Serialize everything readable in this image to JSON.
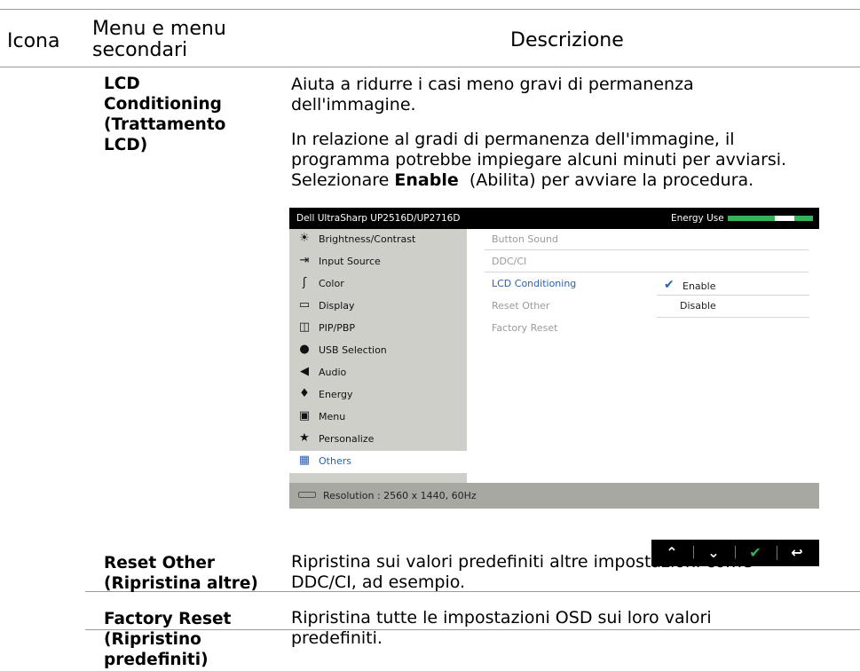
{
  "header": {
    "col_icon": "Icona",
    "col_menu_line1": "Menu e menu",
    "col_menu_line2": "secondari",
    "col_desc": "Descrizione"
  },
  "rows": [
    {
      "term_lines": [
        "LCD",
        "Conditioning",
        "(Trattamento",
        "LCD)"
      ],
      "desc_lines": [
        "Aiuta a ridurre i casi meno gravi di permanenza",
        "dell'immagine."
      ],
      "desc2_lines": [
        "In relazione al gradi di permanenza dell'immagine, il",
        "programma potrebbe impiegare alcuni minuti per avviarsi."
      ],
      "desc3_pre": "Selezionare ",
      "desc3_bold": "Enable",
      "desc3_post": "  (Abilita) per avviare la procedura."
    },
    {
      "term_lines": [
        "Reset Other",
        "(Ripristina altre)"
      ],
      "desc_lines": [
        "Ripristina sui valori predefiniti altre impostazioni come",
        "DDC/CI, ad esempio."
      ]
    },
    {
      "term_lines": [
        "Factory Reset",
        "(Ripristino",
        "predefiniti)"
      ],
      "desc_lines": [
        "Ripristina tutte le impostazioni OSD sui loro valori",
        "predefiniti."
      ]
    }
  ],
  "osd": {
    "title": "Dell UltraSharp UP2516D/UP2716D",
    "energy_label": "Energy Use",
    "energy_level_fraction": 0.78,
    "menu": [
      {
        "label": "Brightness/Contrast",
        "icon": "brightness-icon",
        "active": false
      },
      {
        "label": "Input Source",
        "icon": "input-source-icon",
        "active": false
      },
      {
        "label": "Color",
        "icon": "color-icon",
        "active": false
      },
      {
        "label": "Display",
        "icon": "display-icon",
        "active": false
      },
      {
        "label": "PIP/PBP",
        "icon": "pip-icon",
        "active": false
      },
      {
        "label": "USB Selection",
        "icon": "usb-mouse-icon",
        "active": false
      },
      {
        "label": "Audio",
        "icon": "speaker-icon",
        "active": false
      },
      {
        "label": "Energy",
        "icon": "energy-icon",
        "active": false
      },
      {
        "label": "Menu",
        "icon": "menu-icon",
        "active": false
      },
      {
        "label": "Personalize",
        "icon": "star-icon",
        "active": false
      },
      {
        "label": "Others",
        "icon": "others-icon",
        "active": true
      }
    ],
    "submenu": [
      "Button Sound",
      "DDC/CI",
      "LCD Conditioning",
      "Reset Other",
      "Factory Reset"
    ],
    "submenu_active": "LCD Conditioning",
    "options": {
      "enable": "Enable",
      "disable": "Disable",
      "selected": "Enable"
    },
    "resolution": "Resolution : 2560 x 1440, 60Hz",
    "nav_buttons": [
      "up-icon",
      "down-icon",
      "check-icon",
      "back-icon"
    ],
    "colors": {
      "accent": "#2a5fb0",
      "energy": "#35b35a",
      "check": "#35b35a"
    }
  }
}
